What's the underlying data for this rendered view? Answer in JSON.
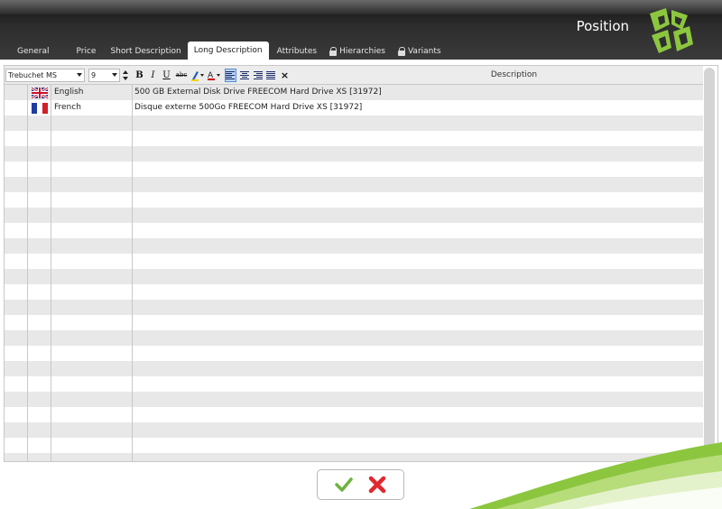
{
  "header": {
    "title": "Position"
  },
  "tabs": [
    {
      "label": "General",
      "active": false,
      "locked": false
    },
    {
      "label": "Price",
      "active": false,
      "locked": false
    },
    {
      "label": "Short Description",
      "active": false,
      "locked": false
    },
    {
      "label": "Long Description",
      "active": true,
      "locked": false
    },
    {
      "label": "Attributes",
      "active": false,
      "locked": false
    },
    {
      "label": "Hierarchies",
      "active": false,
      "locked": true
    },
    {
      "label": "Variants",
      "active": false,
      "locked": true
    }
  ],
  "toolbar": {
    "font_value": "Trebuchet MS",
    "size_value": "9",
    "bold": "B",
    "italic": "I",
    "underline": "U",
    "strike": "abc",
    "clear": "×"
  },
  "grid": {
    "description_header": "Description",
    "rows": [
      {
        "language": "English",
        "flag": "uk-flag-icon",
        "description": "500 GB External Disk Drive FREECOM Hard Drive XS [31972]"
      },
      {
        "language": "French",
        "flag": "fr-flag-icon",
        "description": "Disque externe 500Go FREECOM Hard Drive XS [31972]"
      }
    ]
  },
  "colors": {
    "header_dark": "#2e2e2e",
    "brand_green": "#8cc63f",
    "active_align": "#b8d4f6"
  }
}
